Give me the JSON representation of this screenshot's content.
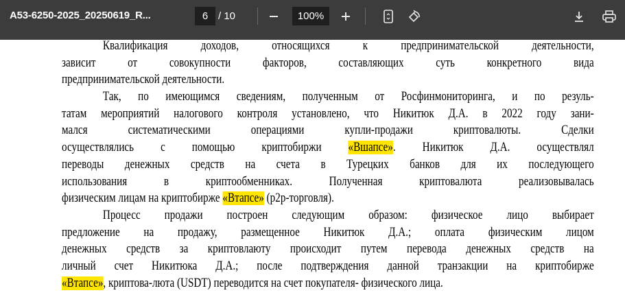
{
  "toolbar": {
    "file_name": "A53-6250-2025_20250619_R...",
    "current_page": "6",
    "total_pages": "/ 10",
    "zoom": "100%",
    "icons": [
      "zoom-out-icon",
      "zoom-in-icon",
      "fit-page-icon",
      "rotate-icon",
      "download-icon",
      "print-icon"
    ]
  },
  "colors": {
    "toolbar_bg": "#3c3c3c",
    "highlight": "#ffe500"
  },
  "document": {
    "lines": [
      {
        "indent": true,
        "justify": true,
        "segments": [
          {
            "text": "Квалификация доходов, относящихся к предпринимательской деятельности,"
          }
        ]
      },
      {
        "justify": true,
        "segments": [
          {
            "text": "зависит от совокупности факторов, составляющих суть конкретного вида"
          }
        ]
      },
      {
        "segments": [
          {
            "text": "предпринимательской деятельности."
          }
        ]
      },
      {
        "indent": true,
        "justify": true,
        "segments": [
          {
            "text": "Так, по имеющимся сведениям, полученным от Росфинмониторинга, и по резуль-"
          }
        ]
      },
      {
        "justify": true,
        "segments": [
          {
            "text": "татам мероприятий налогового контроля установлено, что Никитюк Д.А. в 2022 году зани-"
          }
        ]
      },
      {
        "justify": true,
        "segments": [
          {
            "text": "мался систематическими операциями купли-продажи криптовалюты. Сделки"
          }
        ]
      },
      {
        "justify": true,
        "segments": [
          {
            "text": "осуществлялись с помощью криптобиржи "
          },
          {
            "text": "«Вшапсе»",
            "highlight": true
          },
          {
            "text": ". Никитюк Д.А. осуществлял"
          }
        ]
      },
      {
        "justify": true,
        "segments": [
          {
            "text": "переводы денежных средств на счета в Турецких банков для их последующего"
          }
        ]
      },
      {
        "justify": true,
        "segments": [
          {
            "text": "использования в криптообменниках. Полученная криптовалюта реализовывалась"
          }
        ]
      },
      {
        "segments": [
          {
            "text": "физическим лицам на криптобирже "
          },
          {
            "text": "«Втапсе»",
            "highlight": true
          },
          {
            "text": " (p2p-торговля)."
          }
        ]
      },
      {
        "indent": true,
        "justify": true,
        "segments": [
          {
            "text": "Процесс продажи построен следующим образом: физическое лицо выбирает"
          }
        ]
      },
      {
        "justify": true,
        "segments": [
          {
            "text": "предложение на продажу, размещенное Никитюк Д.А.;  оплата физическим лицом"
          }
        ]
      },
      {
        "justify": true,
        "segments": [
          {
            "text": "денежных средств за криптовлаюту происходит путем перевода денежных средств на"
          }
        ]
      },
      {
        "justify": true,
        "segments": [
          {
            "text": "личный счет Никитюка Д.А.; после подтверждения данной транзакции на криптобирже"
          }
        ]
      },
      {
        "segments": [
          {
            "text": "«Втапсе»",
            "highlight": true
          },
          {
            "text": ", криптова-люта (USDT) переводится на счет покупателя- физического лица."
          }
        ]
      }
    ]
  }
}
